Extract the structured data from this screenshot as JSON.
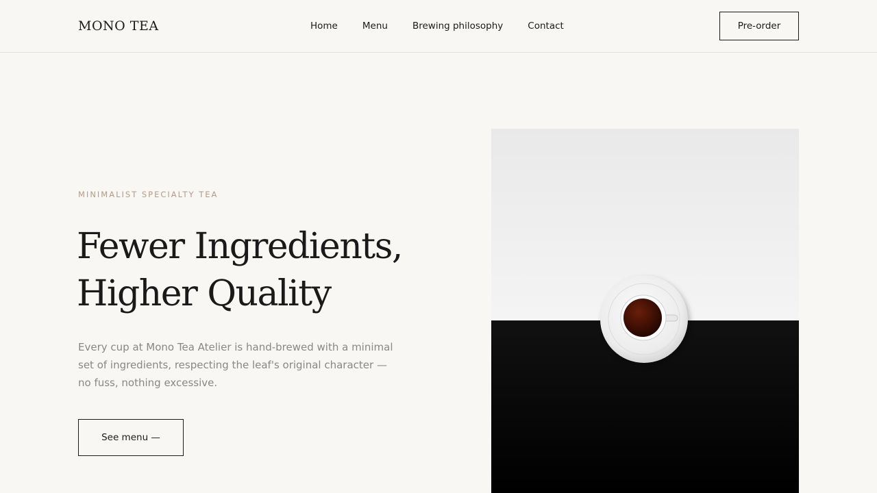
{
  "header": {
    "logo": "MONO TEA",
    "nav": [
      {
        "label": "Home"
      },
      {
        "label": "Menu"
      },
      {
        "label": "Brewing philosophy"
      },
      {
        "label": "Contact"
      }
    ],
    "cta_label": "Pre-order"
  },
  "hero": {
    "eyebrow": "MINIMALIST SPECIALTY TEA",
    "title_line1": "Fewer Ingredients,",
    "title_line2": "Higher Quality",
    "description": "Every cup at Mono Tea Atelier is hand-brewed with a minimal set of ingredients, respecting the leaf's original character — no fuss, nothing excessive.",
    "button_label": "See menu —"
  },
  "colors": {
    "background": "#f8f7f4",
    "text": "#1a1a1a",
    "eyebrow": "#b49a86",
    "muted": "#8a8784"
  }
}
